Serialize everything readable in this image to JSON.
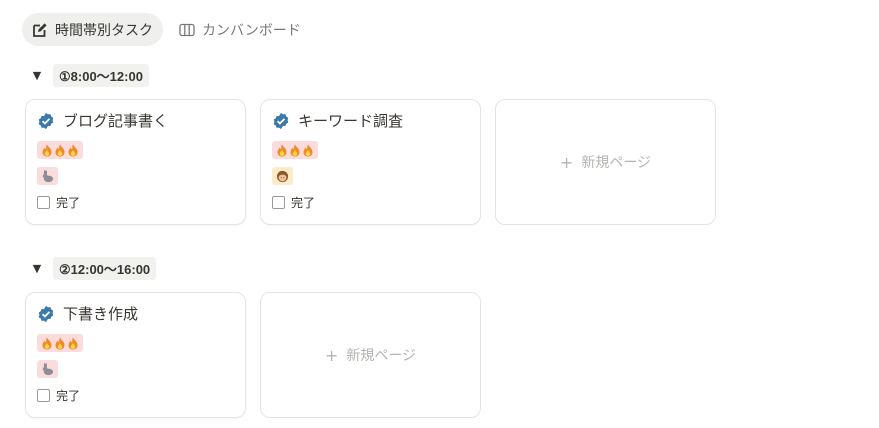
{
  "tabs": [
    {
      "label": "時間帯別タスク",
      "icon": "edit-icon",
      "active": true
    },
    {
      "label": "カンバンボード",
      "icon": "board-columns-icon",
      "active": false
    }
  ],
  "groups": [
    {
      "label": "①8:00〜12:00",
      "cards": [
        {
          "title": "ブログ記事書く",
          "priority": "🔥🔥🔥",
          "speed": "🐇",
          "done_label": "完了"
        },
        {
          "title": "キーワード調査",
          "priority": "🔥🔥🔥",
          "speed": "👧",
          "done_label": "完了"
        }
      ],
      "new_page_label": "新規ページ"
    },
    {
      "label": "②12:00〜16:00",
      "cards": [
        {
          "title": "下書き作成",
          "priority": "🔥🔥🔥",
          "speed": "🐇",
          "done_label": "完了"
        }
      ],
      "new_page_label": "新規ページ"
    }
  ],
  "colors": {
    "verified_blue": "#3b79a8",
    "tag_red": "#fbdcdc",
    "tag_yellow": "#fbecc8",
    "active_tab_bg": "#efefee"
  }
}
